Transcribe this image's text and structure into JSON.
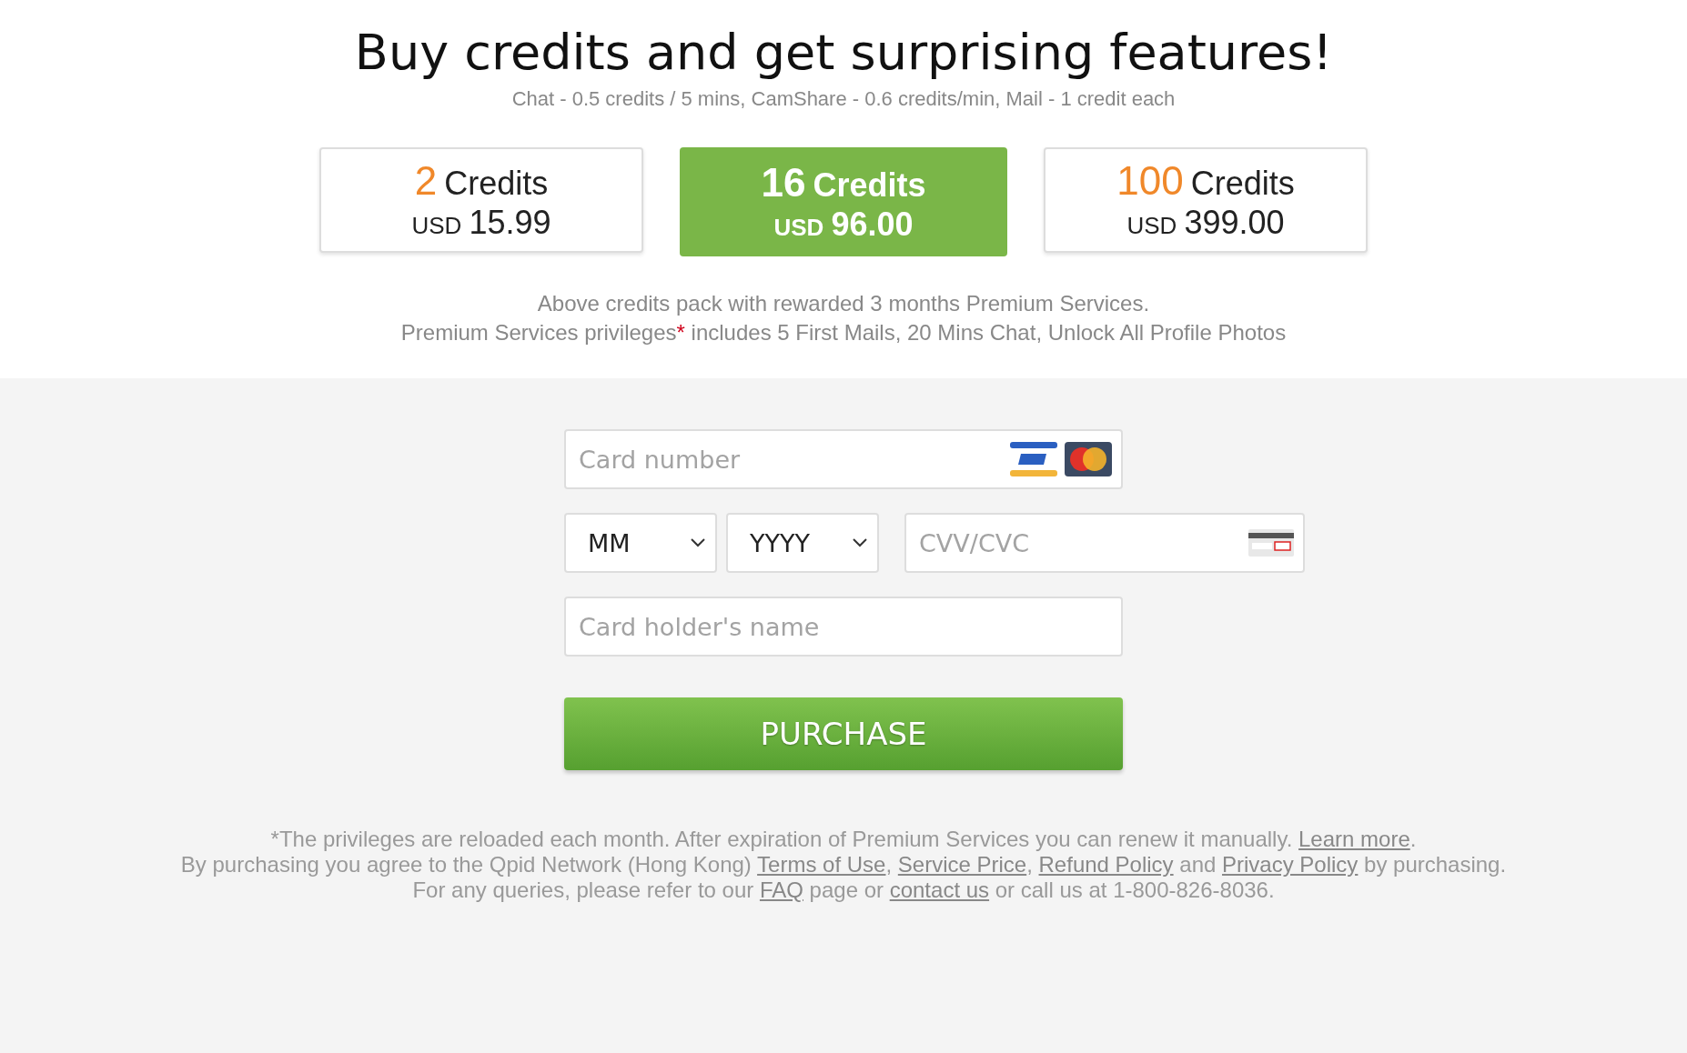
{
  "title": "Buy credits and get surprising features!",
  "subtitle": "Chat - 0.5 credits / 5 mins, CamShare - 0.6 credits/min, Mail - 1 credit each",
  "packages": [
    {
      "amount": "2",
      "unit": "Credits",
      "currency": "USD",
      "price": "15.99",
      "selected": false
    },
    {
      "amount": "16",
      "unit": "Credits",
      "currency": "USD",
      "price": "96.00",
      "selected": true
    },
    {
      "amount": "100",
      "unit": "Credits",
      "currency": "USD",
      "price": "399.00",
      "selected": false
    }
  ],
  "notes": [
    [
      {
        "kind": "text",
        "text": "Above credits pack with rewarded 3 months Premium Services."
      }
    ],
    [
      {
        "kind": "text",
        "text": "Premium Services privileges"
      },
      {
        "kind": "mark",
        "text": "*"
      },
      {
        "kind": "text",
        "text": " includes 5 First Mails, 20 Mins Chat, Unlock All Profile Photos"
      }
    ]
  ],
  "form": {
    "card_number": {
      "placeholder": "Card number"
    },
    "month": {
      "value": "MM"
    },
    "year": {
      "value": "YYYY"
    },
    "cvv": {
      "placeholder": "CVV/CVC"
    },
    "holder": {
      "placeholder": "Card holder's name"
    },
    "button": "PURCHASE"
  },
  "footer": [
    [
      {
        "kind": "text",
        "text": "*The privileges are reloaded each month. After expiration of Premium Services you can renew it manually. "
      },
      {
        "kind": "link",
        "text": "Learn more"
      },
      {
        "kind": "text",
        "text": "."
      }
    ],
    [
      {
        "kind": "text",
        "text": "By purchasing you agree to the Qpid Network (Hong Kong) "
      },
      {
        "kind": "link",
        "text": "Terms of Use"
      },
      {
        "kind": "text",
        "text": ", "
      },
      {
        "kind": "link",
        "text": "Service Price"
      },
      {
        "kind": "text",
        "text": ", "
      },
      {
        "kind": "link",
        "text": "Refund Policy"
      },
      {
        "kind": "text",
        "text": " and "
      },
      {
        "kind": "link",
        "text": "Privacy Policy"
      },
      {
        "kind": "text",
        "text": " by purchasing."
      }
    ],
    [
      {
        "kind": "text",
        "text": "For any queries, please refer to our "
      },
      {
        "kind": "link",
        "text": "FAQ"
      },
      {
        "kind": "text",
        "text": " page or "
      },
      {
        "kind": "link",
        "text": "contact us"
      },
      {
        "kind": "text",
        "text": " or call us at 1-800-826-8036."
      }
    ]
  ]
}
